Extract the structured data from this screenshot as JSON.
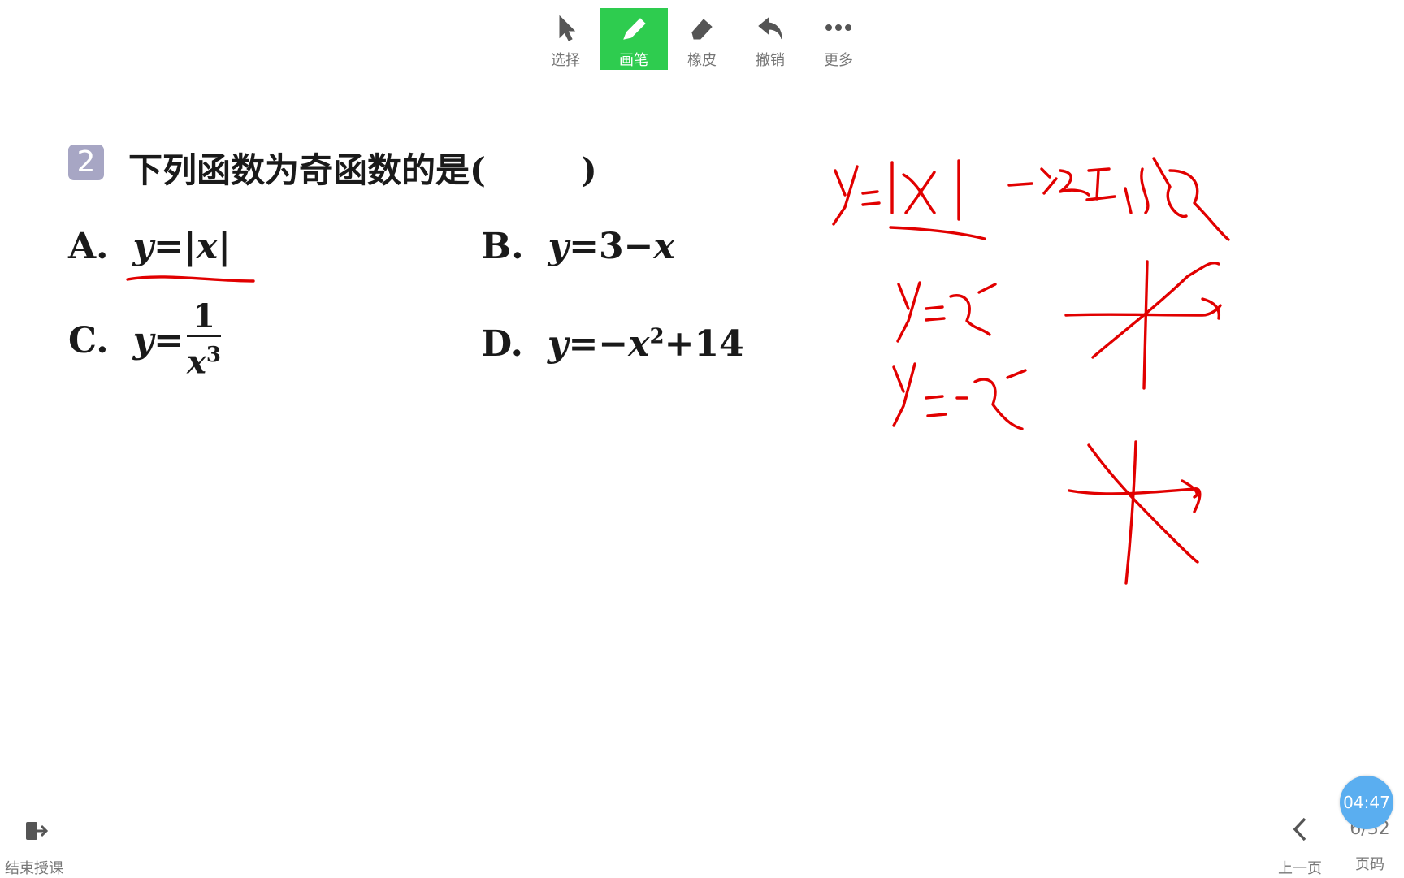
{
  "question": {
    "number": "2",
    "stem": "下列函数为奇函数的是(        )"
  },
  "options": {
    "a": {
      "letter": "A.",
      "lhs": "y",
      "eq": "=",
      "rhs": "|x|"
    },
    "b": {
      "letter": "B.",
      "lhs": "y",
      "eq": "=",
      "rhs_num": "3",
      "minus": "−",
      "rhs_var": "x"
    },
    "c": {
      "letter": "C.",
      "lhs": "y",
      "eq": "=",
      "numerator": "1",
      "denominator": "x",
      "exponent": "3"
    },
    "d": {
      "letter": "D.",
      "lhs": "y",
      "eq": "=",
      "minus": "−",
      "var": "x",
      "exponent": "2",
      "plus": "+",
      "constant": "14"
    }
  },
  "toolbar": {
    "exit_label": "结束授课",
    "select_label": "选择",
    "pen_label": "画笔",
    "eraser_label": "橡皮",
    "undo_label": "撤销",
    "more_label": "更多",
    "prev_label": "上一页",
    "page_label": "页码",
    "page_count": "6/32",
    "active_tool": "pen"
  },
  "timer": {
    "value": "04:47"
  },
  "colors": {
    "ink": "#e10000",
    "active_tool_bg": "#2ecc4f",
    "timer_bg": "#5aaef0",
    "badge": "#a7a6c4"
  }
}
